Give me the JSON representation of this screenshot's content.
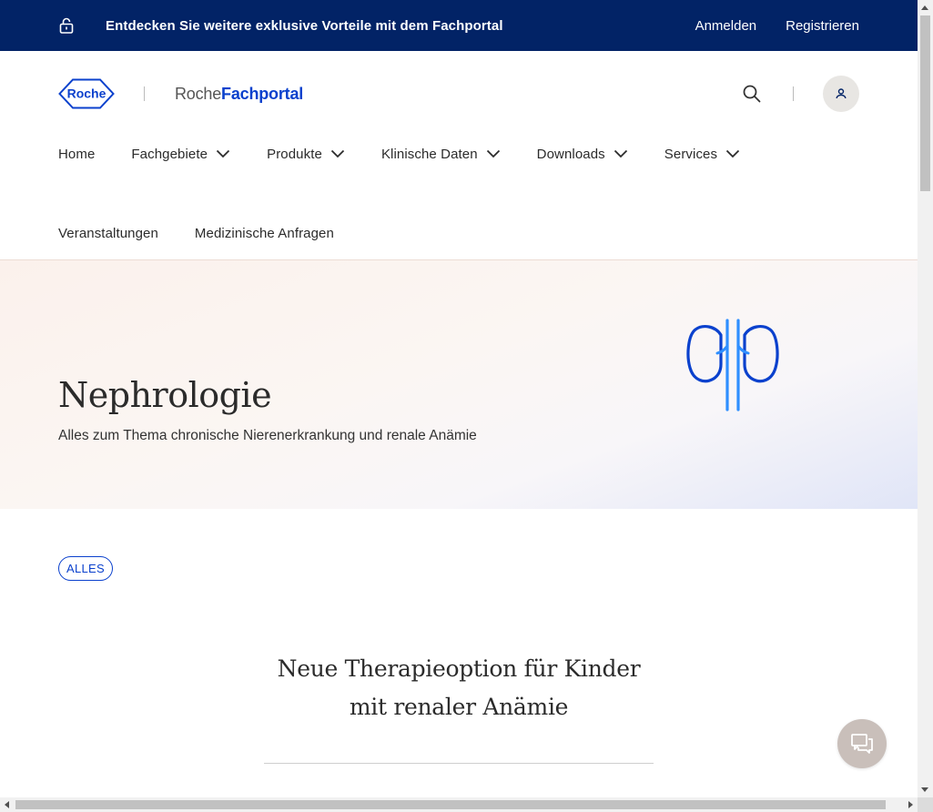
{
  "topbar": {
    "promo": "Entdecken Sie weitere exklusive Vorteile mit dem Fachportal",
    "login": "Anmelden",
    "register": "Registrieren",
    "icon": "unlock-icon",
    "background": "#022366"
  },
  "header": {
    "logo_text": "Roche",
    "brand_part1": "Roche",
    "brand_part2": "Fachportal",
    "search_icon": "search-icon",
    "user_icon": "user-icon",
    "accent": "#0b41cd"
  },
  "nav": {
    "row1": [
      {
        "label": "Home",
        "dropdown": false
      },
      {
        "label": "Fachgebiete",
        "dropdown": true
      },
      {
        "label": "Produkte",
        "dropdown": true
      },
      {
        "label": "Klinische Daten",
        "dropdown": true
      },
      {
        "label": "Downloads",
        "dropdown": true
      },
      {
        "label": "Services",
        "dropdown": true
      }
    ],
    "row2": [
      {
        "label": "Veranstaltungen"
      },
      {
        "label": "Medizinische Anfragen"
      }
    ]
  },
  "hero": {
    "title": "Nephrologie",
    "subtitle": "Alles zum Thema chronische Nierenerkrankung und renale Anämie",
    "icon": "kidney-icon"
  },
  "filters": {
    "active": "ALLES"
  },
  "article": {
    "title_line1": "Neue Therapieoption für Kinder",
    "title_line2": "mit renaler Anämie"
  },
  "chat": {
    "icon": "chat-icon"
  }
}
